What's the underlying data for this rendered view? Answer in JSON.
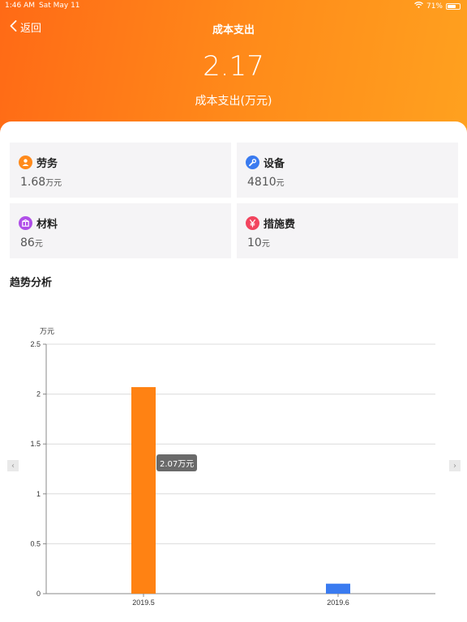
{
  "status": {
    "time": "1:46 AM",
    "date": "Sat May 11",
    "battery": "71%",
    "battery_level": 0.71
  },
  "nav": {
    "back_label": "返回",
    "title": "成本支出"
  },
  "summary": {
    "total": "2.17",
    "total_label": "成本支出(万元)"
  },
  "categories": [
    {
      "label": "劳务",
      "value": "1.68",
      "unit": "万元",
      "icon": "person-icon",
      "color": "#ff8a1c"
    },
    {
      "label": "设备",
      "value": "4810",
      "unit": "元",
      "icon": "wrench-icon",
      "color": "#3a7bf0"
    },
    {
      "label": "材料",
      "value": "86",
      "unit": "元",
      "icon": "box-icon",
      "color": "#b04fe8"
    },
    {
      "label": "措施费",
      "value": "10",
      "unit": "元",
      "icon": "yen-icon",
      "color": "#f2445e"
    }
  ],
  "trend": {
    "title": "趋势分析",
    "tooltip": "2.07万元"
  },
  "chart_data": {
    "type": "bar",
    "categories": [
      "2019.5",
      "2019.6"
    ],
    "values": [
      2.07,
      0.1
    ],
    "bar_colors": [
      "#ff8213",
      "#3a7bf0"
    ],
    "ylabel": "万元",
    "ylim": [
      0,
      2.5
    ],
    "yticks": [
      "0",
      "0.5",
      "1",
      "1.5",
      "2",
      "2.5"
    ],
    "grid": true
  }
}
